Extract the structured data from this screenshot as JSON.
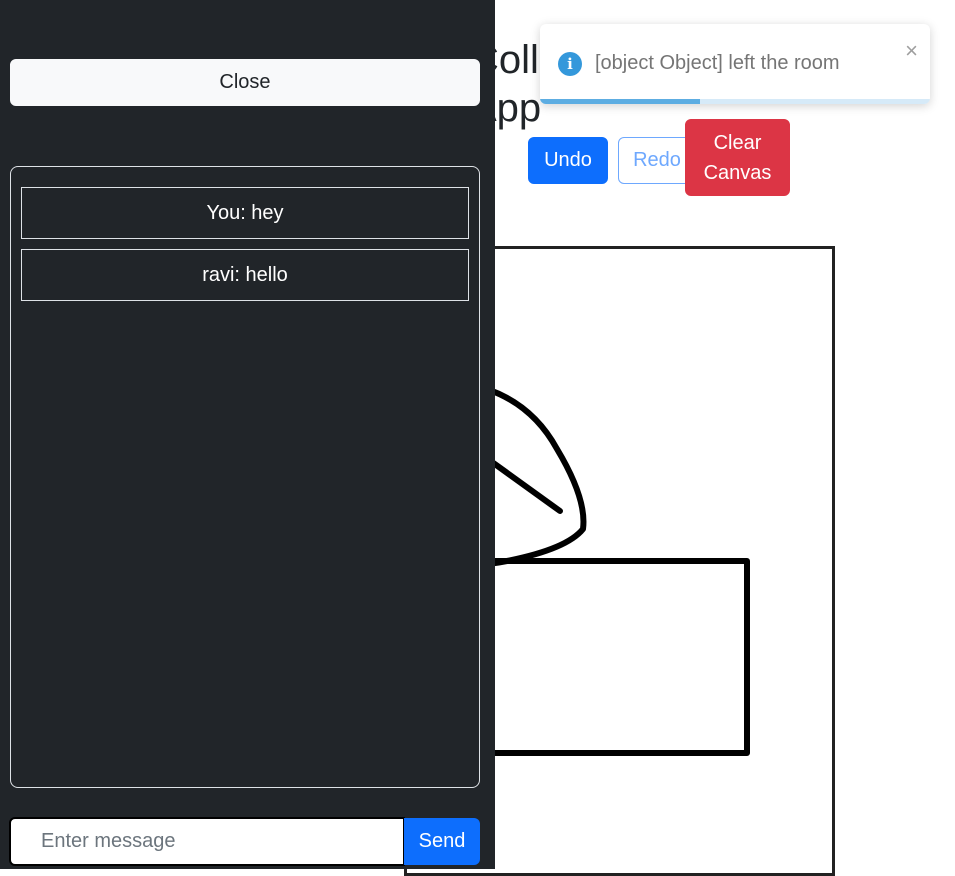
{
  "app": {
    "title": "Collaborative Whiteboard App"
  },
  "toolbar": {
    "undo_label": "Undo",
    "redo_label": "Redo",
    "clear_label": "Clear Canvas"
  },
  "toast": {
    "message": "[object Object] left the room",
    "close_symbol": "×",
    "icon": "info-icon",
    "info_symbol": "i",
    "progress": 0.41,
    "color": "#3498db"
  },
  "chat": {
    "close_label": "Close",
    "messages": [
      {
        "text": "You: hey"
      },
      {
        "text": "ravi: hello"
      }
    ],
    "input_placeholder": "Enter message",
    "input_value": "",
    "send_label": "Send"
  },
  "colors": {
    "primary": "#0d6efd",
    "danger": "#dc3545",
    "panel": "#212529"
  }
}
